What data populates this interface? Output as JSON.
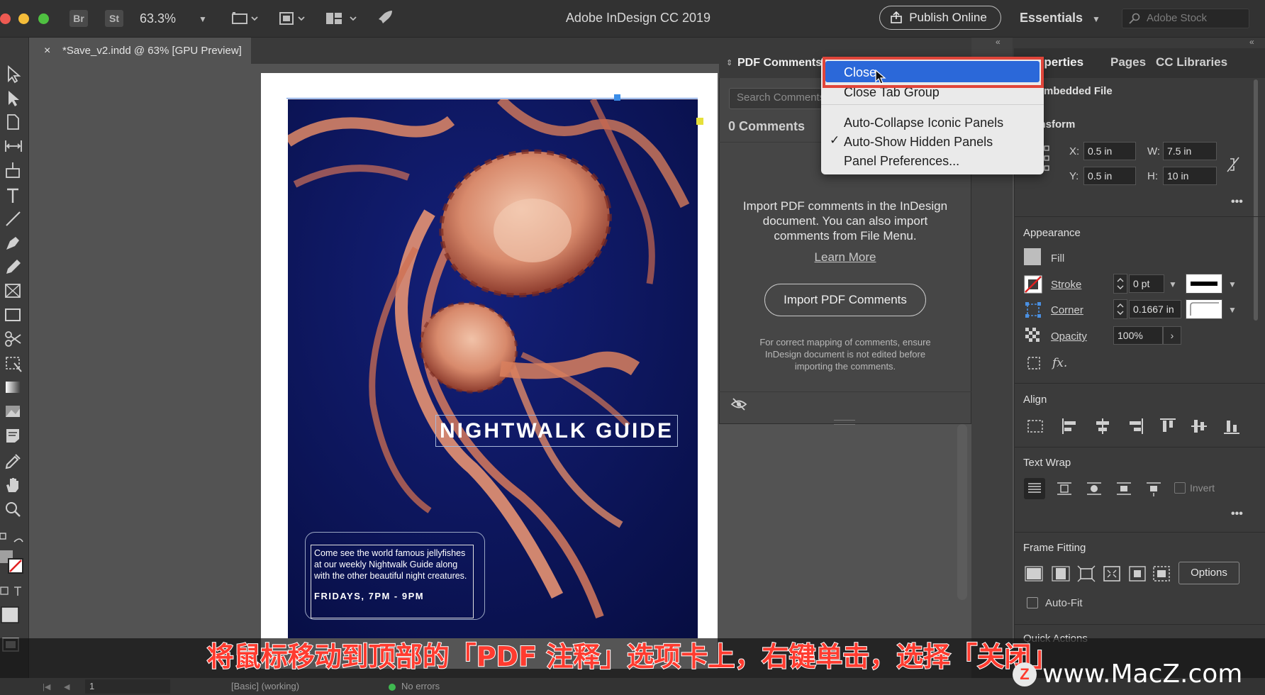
{
  "app": {
    "title": "Adobe InDesign CC 2019",
    "zoom": "63.3%",
    "bridge_label": "Br",
    "stock_label": "St",
    "publish_online": "Publish Online",
    "workspace": "Essentials",
    "stock_search_placeholder": "Adobe Stock"
  },
  "document_tab": {
    "close_glyph": "×",
    "label": "*Save_v2.indd @ 63% [GPU Preview]"
  },
  "poster": {
    "title": "NIGHTWALK GUIDE",
    "caption_lines": [
      "Come see the world famous jellyfishes",
      "at our weekly Nightwalk Guide along",
      "with the other beautiful night creatures."
    ],
    "date": "FRIDAYS, 7PM - 9PM"
  },
  "pdf_panel": {
    "title": "PDF Comments",
    "search_placeholder": "Search Comments",
    "count": "0 Comments",
    "info_lines": [
      "Import PDF comments in the InDesign",
      "document. You can also import",
      "comments from File Menu."
    ],
    "learn_more": "Learn More",
    "import_button": "Import PDF Comments",
    "note_lines": [
      "For correct mapping of comments, ensure",
      "InDesign document is not edited before",
      "importing the comments."
    ]
  },
  "context_menu": {
    "items": [
      {
        "label": "Close",
        "highlighted": true
      },
      {
        "label": "Close Tab Group"
      },
      {
        "label": "Auto-Collapse Iconic Panels"
      },
      {
        "label": "Auto-Show Hidden Panels",
        "checked": true
      },
      {
        "label": "Panel Preferences..."
      }
    ],
    "checkmark": "✓"
  },
  "properties": {
    "tabs": [
      "Properties",
      "Pages",
      "CC Libraries"
    ],
    "context": "Embedded File",
    "transform": {
      "header": "Transform",
      "x_label": "X:",
      "x": "0.5 in",
      "y_label": "Y:",
      "y": "0.5 in",
      "w_label": "W:",
      "w": "7.5 in",
      "h_label": "H:",
      "h": "10 in"
    },
    "appearance": {
      "header": "Appearance",
      "fill": "Fill",
      "stroke": "Stroke",
      "stroke_value": "0 pt",
      "corner": "Corner",
      "corner_value": "0.1667 in",
      "opacity": "Opacity",
      "opacity_value": "100%",
      "fx": "fx."
    },
    "align": {
      "header": "Align"
    },
    "text_wrap": {
      "header": "Text Wrap",
      "invert": "Invert"
    },
    "frame_fitting": {
      "header": "Frame Fitting",
      "options": "Options",
      "auto_fit": "Auto-Fit"
    },
    "quick_actions": {
      "header": "Quick Actions"
    }
  },
  "status_bar": {
    "page": "1",
    "preflight_profile": "[Basic] (working)",
    "errors": "No errors"
  },
  "overlay": {
    "subtitle": "将鼠标移动到顶部的「PDF 注释」选项卡上，右键单击，选择「关闭」",
    "watermark": "www.MacZ.com",
    "watermark_logo": "Z"
  },
  "colors": {
    "menu_highlight": "#2b68d9",
    "callout_outline": "#e0453a",
    "poster_background": "#0b1450",
    "subtitle_text": "#ff3b2f"
  }
}
